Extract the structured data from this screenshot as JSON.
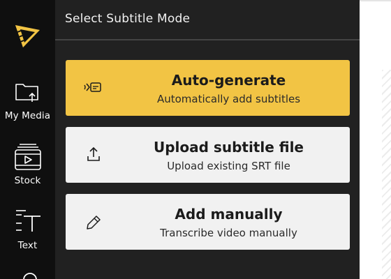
{
  "panel": {
    "title": "Select Subtitle Mode"
  },
  "sidebar": {
    "items": [
      {
        "label": "My Media",
        "icon": "folder-upload-icon"
      },
      {
        "label": "Stock",
        "icon": "stock-film-icon"
      },
      {
        "label": "Text",
        "icon": "text-icon"
      }
    ],
    "partial_icon": "search-icon"
  },
  "options": {
    "auto": {
      "title": "Auto-generate",
      "subtitle": "Automatically add subtitles",
      "icon": "auto-caption-icon",
      "color": "#f2c444"
    },
    "upload": {
      "title": "Upload subtitle file",
      "subtitle": "Upload existing SRT file",
      "icon": "upload-icon"
    },
    "manual": {
      "title": "Add manually",
      "subtitle": "Transcribe video manually",
      "icon": "pencil-icon"
    }
  },
  "colors": {
    "rail": "#0f0f0f",
    "panel": "#212121",
    "accent": "#f2c444",
    "card": "#f1f1f1"
  }
}
